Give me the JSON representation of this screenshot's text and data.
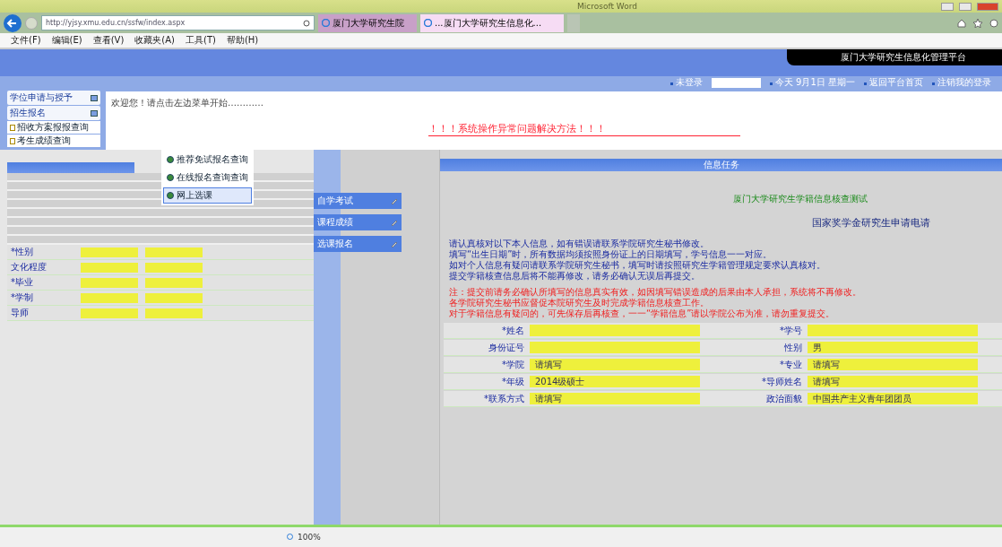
{
  "window": {
    "title": "Microsoft Word"
  },
  "browser": {
    "url": "http://yjsy.xmu.edu.cn/ssfw/index.aspx",
    "tabs": [
      {
        "label": "厦门大学研究生院",
        "selected": false
      },
      {
        "label": "...厦门大学研究生信息化...",
        "selected": true
      }
    ],
    "zoom": "100%"
  },
  "menu": [
    "文件(F)",
    "编辑(E)",
    "查看(V)",
    "收藏夹(A)",
    "工具(T)",
    "帮助(H)"
  ],
  "header": {
    "title": "厦门大学研究生信息化管理平台",
    "nav": [
      "未登录",
      "今天 9月1日 星期一",
      "返回平台首页",
      "注销我的登录"
    ]
  },
  "sidebar": {
    "sections": [
      {
        "label": "学位申请与授予"
      },
      {
        "label": "招生报名",
        "items": [
          "招收方案报报查询",
          "考生成绩查询"
        ]
      }
    ]
  },
  "welcome": "欢迎您！请点击左边菜单开始…………",
  "alert": "！！！系统操作异常问题解决方法！！！",
  "popup_menu": [
    {
      "label": "推荐免试报名查询",
      "selected": false
    },
    {
      "label": "在线报名查询查询",
      "selected": false
    },
    {
      "label": "网上选课",
      "selected": true
    }
  ],
  "float_menu": [
    "自学考试",
    "课程成绩",
    "选课报名"
  ],
  "left_form": {
    "rows": [
      {
        "label": "*性别"
      },
      {
        "label": "文化程度"
      },
      {
        "label": "*毕业"
      },
      {
        "label": "*学制"
      },
      {
        "label": "导师"
      }
    ]
  },
  "panel": {
    "title": "信息任务",
    "heading": "厦门大学研究生学籍信息核查测试",
    "subheading": "国家奖学金研究生申请电请",
    "notes": [
      {
        "kind": "info",
        "text": "请认真核对以下本人信息，如有错误请联系学院研究生秘书修改。"
      },
      {
        "kind": "info",
        "text": "填写“出生日期”时，所有数据均须按照身份证上的日期填写，学号信息一一对应。"
      },
      {
        "kind": "info",
        "text": "如对个人信息有疑问请联系学院研究生秘书，填写时请按照研究生学籍管理规定要求认真核对。"
      },
      {
        "kind": "info",
        "text": "提交学籍核查信息后将不能再修改，请务必确认无误后再提交。"
      },
      {
        "kind": "warn",
        "text": "注：提交前请务必确认所填写的信息真实有效，如因填写错误造成的后果由本人承担，系统将不再修改。"
      },
      {
        "kind": "warn",
        "text": "各学院研究生秘书应督促本院研究生及时完成学籍信息核查工作。"
      },
      {
        "kind": "warn",
        "text": "对于学籍信息有疑问的，可先保存后再核查，一一“学籍信息”请以学院公布为准，请勿重复提交。"
      }
    ],
    "rows": [
      [
        {
          "label": "*姓名"
        },
        {
          "label": "*学号"
        }
      ],
      [
        {
          "label": "身份证号"
        },
        {
          "label": "性别",
          "value": "男"
        }
      ],
      [
        {
          "label": "*学院",
          "value": "请填写"
        },
        {
          "label": "*专业",
          "value": "请填写"
        }
      ],
      [
        {
          "label": "*年级",
          "value": "2014级硕士"
        },
        {
          "label": "*导师姓名",
          "value": "请填写"
        }
      ],
      [
        {
          "label": "*联系方式",
          "value": "请填写"
        },
        {
          "label": "政治面貌",
          "value": "中国共产主义青年团团员"
        }
      ]
    ]
  }
}
